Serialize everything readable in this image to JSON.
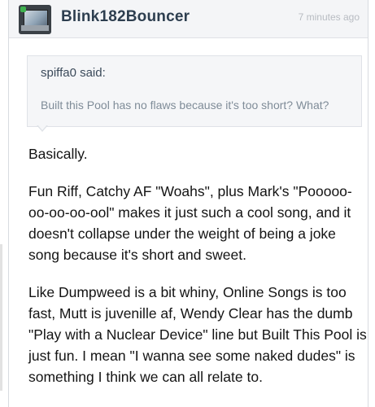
{
  "post": {
    "username": "Blink182Bouncer",
    "timestamp": "7 minutes ago",
    "avatar_icon": "laptop-avatar-icon",
    "status_color": "#3fb24f",
    "quote": {
      "author": "spiffa0 said:",
      "text": "Built this Pool has no flaws because it's too short? What?"
    },
    "paragraphs": [
      "Basically.",
      "Fun Riff, Catchy AF \"Woahs\", plus Mark's \"Pooooo-oo-oo-oo-ool\" makes it just such a cool song, and it doesn't collapse under the weight of being a joke song because it's short and sweet.",
      "Like Dumpweed is a bit whiny, Online Songs is too fast, Mutt is juvenille af, Wendy Clear has the dumb \"Play with a Nuclear Device\" line but Built This Pool is just fun. I mean \"I wanna see some naked dudes\" is something I think we can all relate to."
    ]
  }
}
